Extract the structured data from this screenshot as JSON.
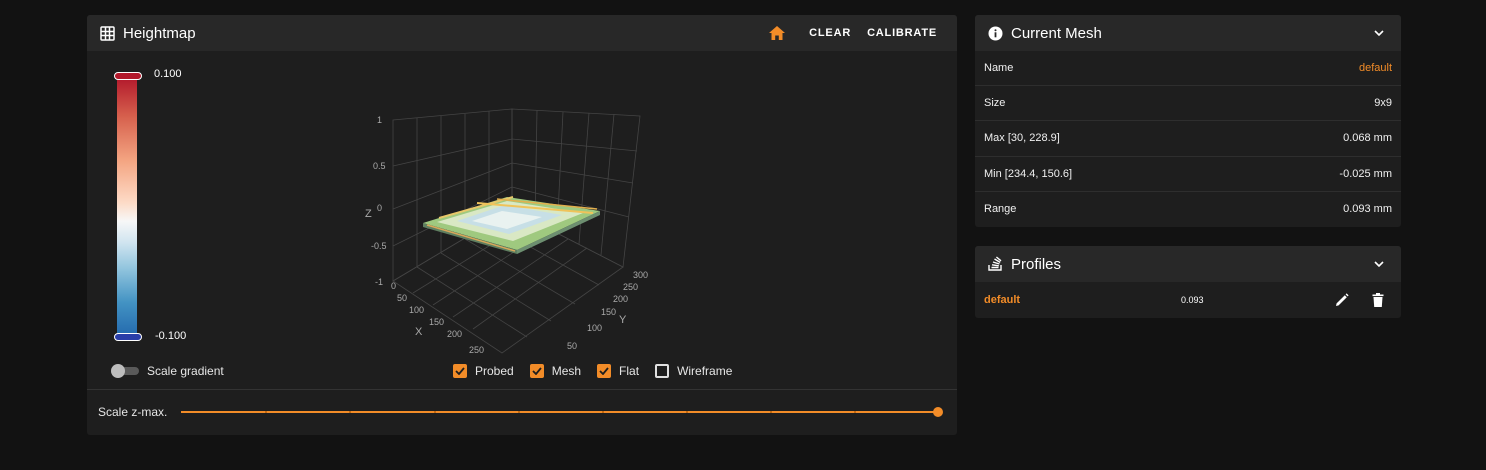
{
  "heightmap": {
    "title": "Heightmap",
    "icon": "grid-icon",
    "actions": {
      "home_icon": "home-icon",
      "clear_label": "CLEAR",
      "calibrate_label": "CALIBRATE"
    },
    "gradient": {
      "max_label": "0.100",
      "min_label": "-0.100",
      "colors": [
        "#b2182b",
        "#f7f7f7",
        "#2166ac"
      ]
    },
    "plot": {
      "z_ticks": [
        "1",
        "0.5",
        "0",
        "-0.5",
        "-1"
      ],
      "z_label": "Z",
      "x_ticks": [
        "0",
        "50",
        "100",
        "150",
        "200",
        "250"
      ],
      "x_label": "X",
      "y_ticks": [
        "300",
        "250",
        "200",
        "150",
        "100",
        "50"
      ],
      "y_label": "Y"
    },
    "scale_gradient": {
      "label": "Scale gradient",
      "on": false
    },
    "options": [
      {
        "label": "Probed",
        "checked": true
      },
      {
        "label": "Mesh",
        "checked": true
      },
      {
        "label": "Flat",
        "checked": true
      },
      {
        "label": "Wireframe",
        "checked": false
      }
    ],
    "scale_zmax": {
      "label": "Scale z-max.",
      "value": 1.0
    },
    "accent": "#f28c28"
  },
  "mesh": {
    "title": "Current Mesh",
    "icon": "info-icon",
    "rows": [
      {
        "key": "Name",
        "value": "default"
      },
      {
        "key": "Size",
        "value": "9x9"
      },
      {
        "key": "Max [30, 228.9]",
        "value": "0.068 mm"
      },
      {
        "key": "Min [234.4, 150.6]",
        "value": "-0.025 mm"
      },
      {
        "key": "Range",
        "value": "0.093 mm"
      }
    ]
  },
  "profiles": {
    "title": "Profiles",
    "icon": "layers-icon",
    "items": [
      {
        "name": "default",
        "range": "0.093"
      }
    ]
  }
}
